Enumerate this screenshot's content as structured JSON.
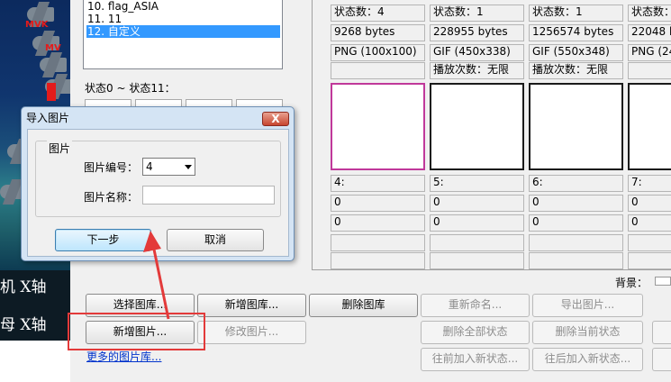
{
  "game_art": {
    "marks": [
      "MVK",
      "MV"
    ],
    "chinese_lines": [
      "机 X轴",
      "母 X轴"
    ]
  },
  "list": {
    "items": [
      "10. flag_ASIA",
      "11. 11",
      "12. 自定义"
    ],
    "selected_index": 2
  },
  "state_range_label": "状态0 ~ 状态11：",
  "states": [
    {
      "count": "状态数：4",
      "size": "9268 bytes",
      "format": "PNG (100x100)",
      "play": "",
      "id": "4:",
      "v1": "0",
      "v2": "0"
    },
    {
      "count": "状态数：1",
      "size": "228955 bytes",
      "format": "GIF (450x338)",
      "play": "播放次数：无限",
      "id": "5:",
      "v1": "0",
      "v2": "0"
    },
    {
      "count": "状态数：1",
      "size": "1256574 bytes",
      "format": "GIF (550x348)",
      "play": "播放次数：无限",
      "id": "6:",
      "v1": "0",
      "v2": "0"
    },
    {
      "count": "状态数：",
      "size": "22048 by",
      "format": "PNG (24",
      "play": "",
      "id": "7:",
      "v1": "0",
      "v2": "0"
    }
  ],
  "buttons": {
    "select_library": "选择图库...",
    "new_library": "新增图库...",
    "delete_library": "删除图库",
    "rename": "重新命名...",
    "export_image": "导出图片...",
    "new_image": "新增图片...",
    "edit_image": "修改图片...",
    "delete_all_states": "删除全部状态",
    "delete_current_state": "删除当前状态",
    "add_state_before": "往前加入新状态...",
    "add_state_after": "往后加入新状态..."
  },
  "background_label": "背景：",
  "more_libraries_link": "更多的图片库...",
  "modal": {
    "title": "导入图片",
    "close": "X",
    "group_label": "图片",
    "number_label": "图片编号：",
    "number_value": "4",
    "name_label": "图片名称：",
    "name_value": "",
    "next_button": "下一步",
    "cancel_button": "取消"
  },
  "colors": {
    "list_selection": "#3399ff",
    "selected_thumb_border": "#c0389a",
    "annotation_red": "#e33a3a"
  }
}
